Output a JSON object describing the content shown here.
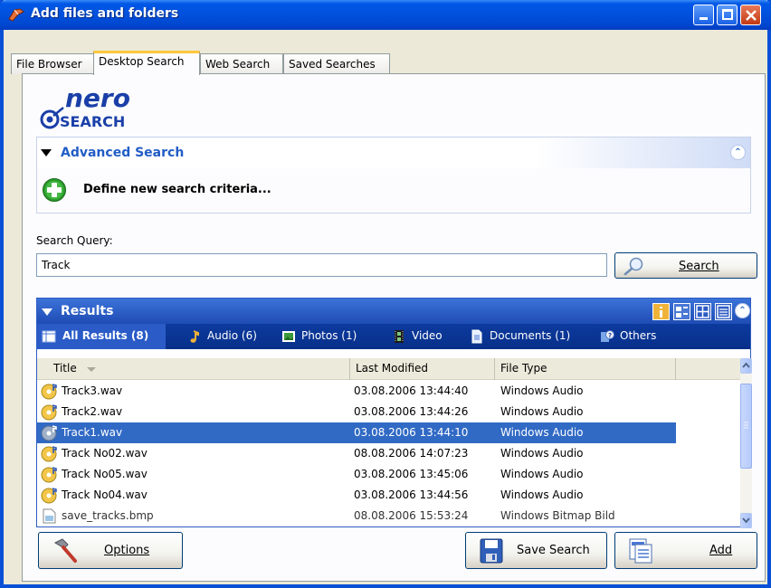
{
  "window": {
    "title": "Add files and folders"
  },
  "tabs": [
    {
      "label": "File Browser"
    },
    {
      "label": "Desktop Search"
    },
    {
      "label": "Web Search"
    },
    {
      "label": "Saved Searches"
    }
  ],
  "logo": {
    "line1": "nero",
    "line2": "SEARCH"
  },
  "advanced": {
    "title": "Advanced Search",
    "define_label": "Define new search criteria..."
  },
  "search": {
    "label": "Search Query:",
    "value": "Track",
    "button_label": "Search"
  },
  "results": {
    "title": "Results",
    "filters": [
      {
        "label": "All Results (8)",
        "icon": "list-icon"
      },
      {
        "label": "Audio (6)",
        "icon": "music-note-icon"
      },
      {
        "label": "Photos (1)",
        "icon": "photo-icon"
      },
      {
        "label": "Video",
        "icon": "film-icon"
      },
      {
        "label": "Documents (1)",
        "icon": "document-icon"
      },
      {
        "label": "Others",
        "icon": "others-icon"
      }
    ],
    "columns": [
      "Title",
      "Last Modified",
      "File Type"
    ],
    "rows": [
      {
        "name": "Track3.wav",
        "modified": "03.08.2006 13:44:40",
        "type": "Windows Audio",
        "selected": false
      },
      {
        "name": "Track2.wav",
        "modified": "03.08.2006 13:44:26",
        "type": "Windows Audio",
        "selected": false
      },
      {
        "name": "Track1.wav",
        "modified": "03.08.2006 13:44:10",
        "type": "Windows Audio",
        "selected": true
      },
      {
        "name": "Track No02.wav",
        "modified": "08.08.2006 14:07:23",
        "type": "Windows Audio",
        "selected": false
      },
      {
        "name": "Track No05.wav",
        "modified": "03.08.2006 13:45:06",
        "type": "Windows Audio",
        "selected": false
      },
      {
        "name": "Track No04.wav",
        "modified": "03.08.2006 13:44:56",
        "type": "Windows Audio",
        "selected": false
      },
      {
        "name": "save_tracks.bmp",
        "modified": "08.08.2006 15:53:24",
        "type": "Windows Bitmap Bild",
        "selected": false
      }
    ]
  },
  "buttons": {
    "options": "Options",
    "save_search": "Save Search",
    "add": "Add"
  },
  "colors": {
    "titlebar": "#0054e3",
    "selection": "#316ac5",
    "results_header": "#2a5bc7",
    "link_blue": "#215dc6"
  }
}
